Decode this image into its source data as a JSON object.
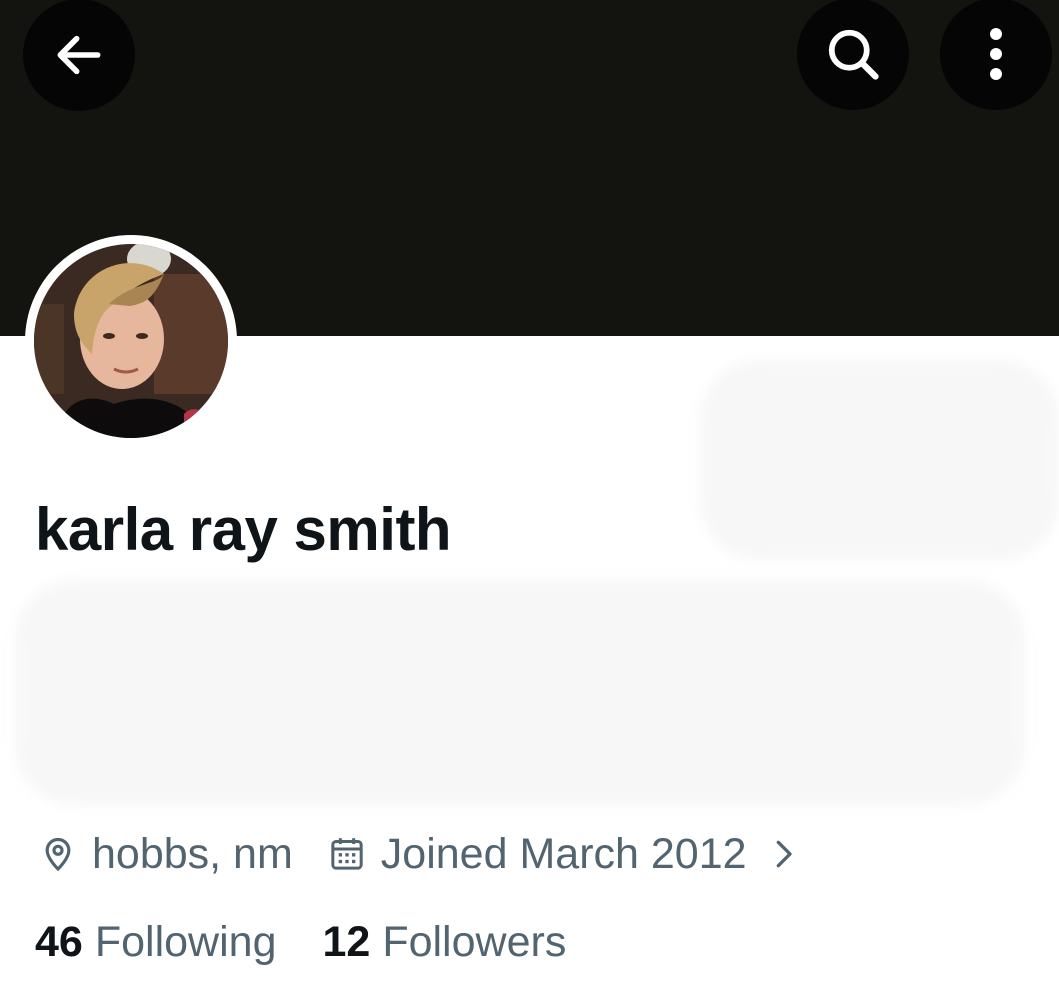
{
  "profile": {
    "display_name": "karla ray smith",
    "location": "hobbs, nm",
    "joined": "Joined March 2012",
    "following_count": "46",
    "following_label": "Following",
    "followers_count": "12",
    "followers_label": "Followers"
  },
  "header": {
    "back_icon": "arrow-left-icon",
    "search_icon": "search-icon",
    "more_icon": "more-vertical-icon"
  },
  "colors": {
    "banner": "#13140f",
    "text_primary": "#0f1419",
    "text_secondary": "#536471"
  }
}
